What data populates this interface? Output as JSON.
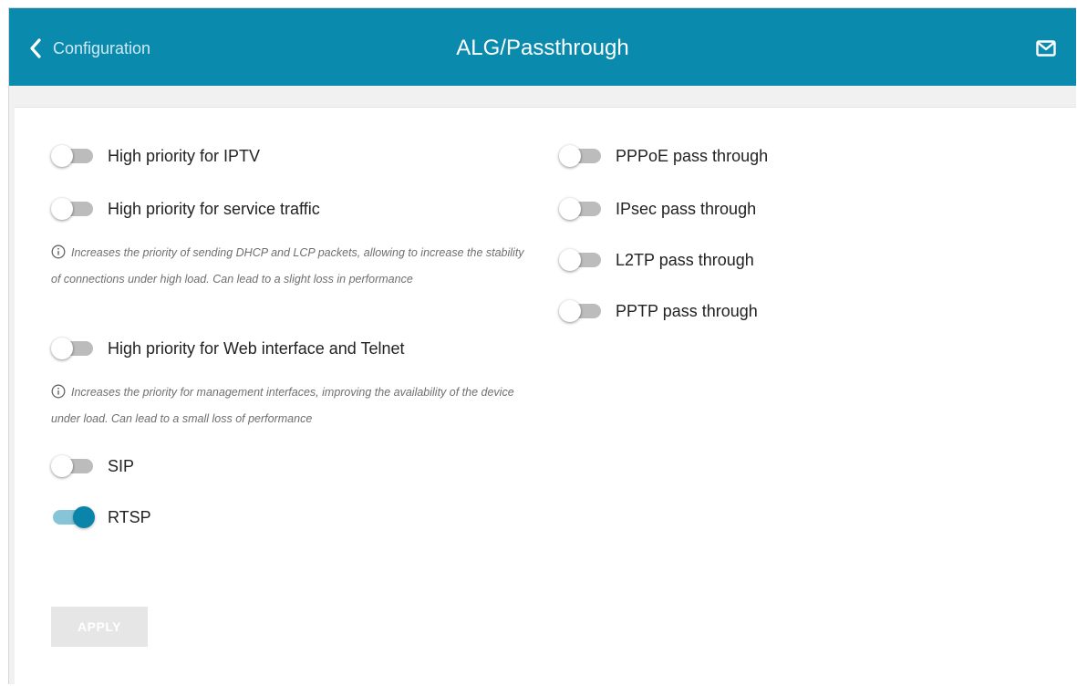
{
  "header": {
    "back_label": "Configuration",
    "title": "ALG/Passthrough",
    "accent_color": "#0a8aad"
  },
  "left": {
    "iptv": {
      "label": "High priority for IPTV",
      "on": false
    },
    "service": {
      "label": "High priority for service traffic",
      "on": false
    },
    "service_hint": "Increases the priority of sending DHCP and LCP packets, allowing to increase the stability of connections under high load. Can lead to a slight loss in performance",
    "web": {
      "label": "High priority for Web interface and Telnet",
      "on": false
    },
    "web_hint": "Increases the priority for management interfaces, improving the availability of the device under load. Can lead to a small loss of performance",
    "sip": {
      "label": "SIP",
      "on": false
    },
    "rtsp": {
      "label": "RTSP",
      "on": true
    }
  },
  "right": {
    "pppoe": {
      "label": "PPPoE pass through",
      "on": false
    },
    "ipsec": {
      "label": "IPsec pass through",
      "on": false
    },
    "l2tp": {
      "label": "L2TP pass through",
      "on": false
    },
    "pptp": {
      "label": "PPTP pass through",
      "on": false
    }
  },
  "apply_label": "APPLY",
  "icons": [
    "chevron-left-icon",
    "mail-icon",
    "info-icon"
  ]
}
